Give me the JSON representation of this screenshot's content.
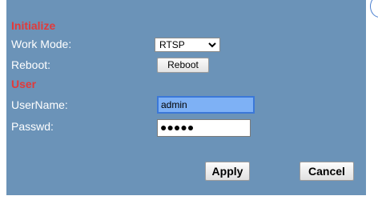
{
  "initialize": {
    "title": "Initialize",
    "work_mode": {
      "label": "Work Mode:",
      "selected": "RTSP"
    },
    "reboot": {
      "label": "Reboot:",
      "button_label": "Reboot"
    }
  },
  "user": {
    "title": "User",
    "username": {
      "label": "UserName:",
      "value": "admin"
    },
    "password": {
      "label": "Passwd:",
      "masked_value": "●●●●●"
    }
  },
  "actions": {
    "apply_label": "Apply",
    "cancel_label": "Cancel"
  },
  "colors": {
    "panel_bg": "#6b93b8",
    "section_title": "#e23a3a",
    "label_text": "#ffffff",
    "focused_field_bg": "#7eb1f5",
    "focused_field_border": "#3b78d8"
  }
}
